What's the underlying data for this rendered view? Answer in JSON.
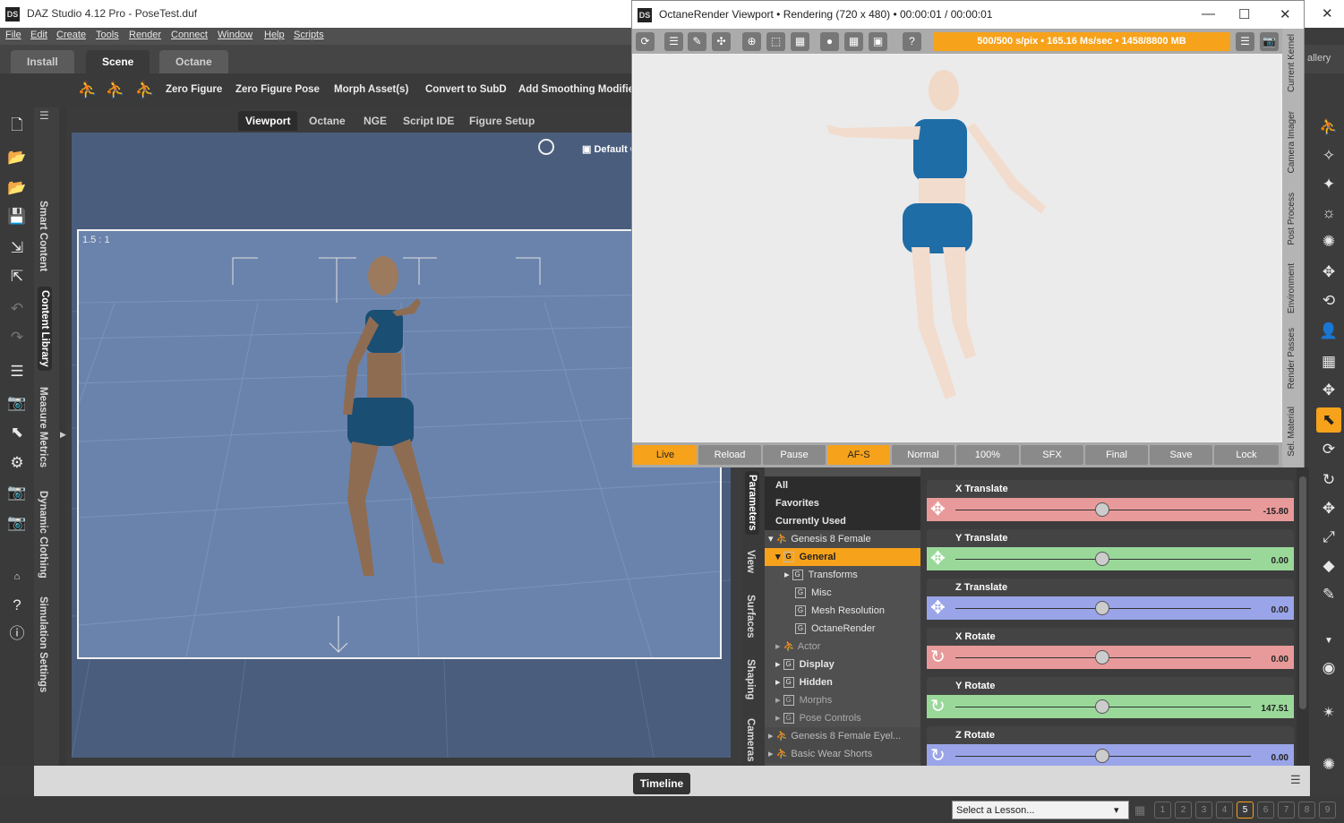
{
  "app_title": "DAZ Studio 4.12 Pro - PoseTest.duf",
  "app_logo": "DS",
  "menu": [
    "File",
    "Edit",
    "Create",
    "Tools",
    "Render",
    "Connect",
    "Window",
    "Help",
    "Scripts"
  ],
  "main_tabs": [
    "Install",
    "Scene",
    "Octane"
  ],
  "gallery_label": "allery",
  "toolbar": [
    "Zero Figure",
    "Zero Figure Pose",
    "Morph Asset(s)",
    "Convert to SubD",
    "Add Smoothing Modifie"
  ],
  "left_tabs": [
    "Smart Content",
    "Content Library",
    "Measure Metrics",
    "Dynamic Clothing",
    "Simulation Settings"
  ],
  "viewport_tabs": [
    "Viewport",
    "Octane",
    "NGE",
    "Script IDE",
    "Figure Setup"
  ],
  "viewport": {
    "ratio": "1.5 : 1",
    "camera": "Default Ca"
  },
  "octane": {
    "title": "OctaneRender Viewport • Rendering (720 x 480) • 00:00:01 / 00:00:01",
    "status": "500/500 s/pix • 165.16 Ms/sec • 1458/8800 MB",
    "side_tabs": [
      "Current Kernel",
      "Camera Imager",
      "Post Process",
      "Environment",
      "Render Passes",
      "Sel. Material"
    ],
    "bottom_buttons": [
      "Live",
      "Reload",
      "Pause",
      "AF-S",
      "Normal",
      "100%",
      "SFX",
      "Final",
      "Save",
      "Lock"
    ],
    "accent": "#f7a21b"
  },
  "param_tabs": [
    "Parameters",
    "View",
    "Surfaces",
    "Shaping",
    "Cameras"
  ],
  "tree": {
    "all": "All",
    "favorites": "Favorites",
    "recent": "Currently Used",
    "items": [
      "Genesis 8 Female",
      "General",
      "Transforms",
      "Misc",
      "Mesh Resolution",
      "OctaneRender",
      "Actor",
      "Display",
      "Hidden",
      "Morphs",
      "Pose Controls",
      "Genesis 8 Female Eyel...",
      "Basic Wear Shorts"
    ]
  },
  "sliders": [
    {
      "label": "X Translate",
      "value": "-15.80",
      "color": "#e89a9a"
    },
    {
      "label": "Y Translate",
      "value": "0.00",
      "color": "#9ad89a"
    },
    {
      "label": "Z Translate",
      "value": "0.00",
      "color": "#9aa4e8"
    },
    {
      "label": "X Rotate",
      "value": "0.00",
      "color": "#e89a9a"
    },
    {
      "label": "Y Rotate",
      "value": "147.51",
      "color": "#9ad89a"
    },
    {
      "label": "Z Rotate",
      "value": "0.00",
      "color": "#9aa4e8"
    }
  ],
  "timeline_label": "Timeline",
  "lesson_placeholder": "Select a Lesson...",
  "pages": [
    "1",
    "2",
    "3",
    "4",
    "5",
    "6",
    "7",
    "8",
    "9"
  ],
  "current_page": "5"
}
